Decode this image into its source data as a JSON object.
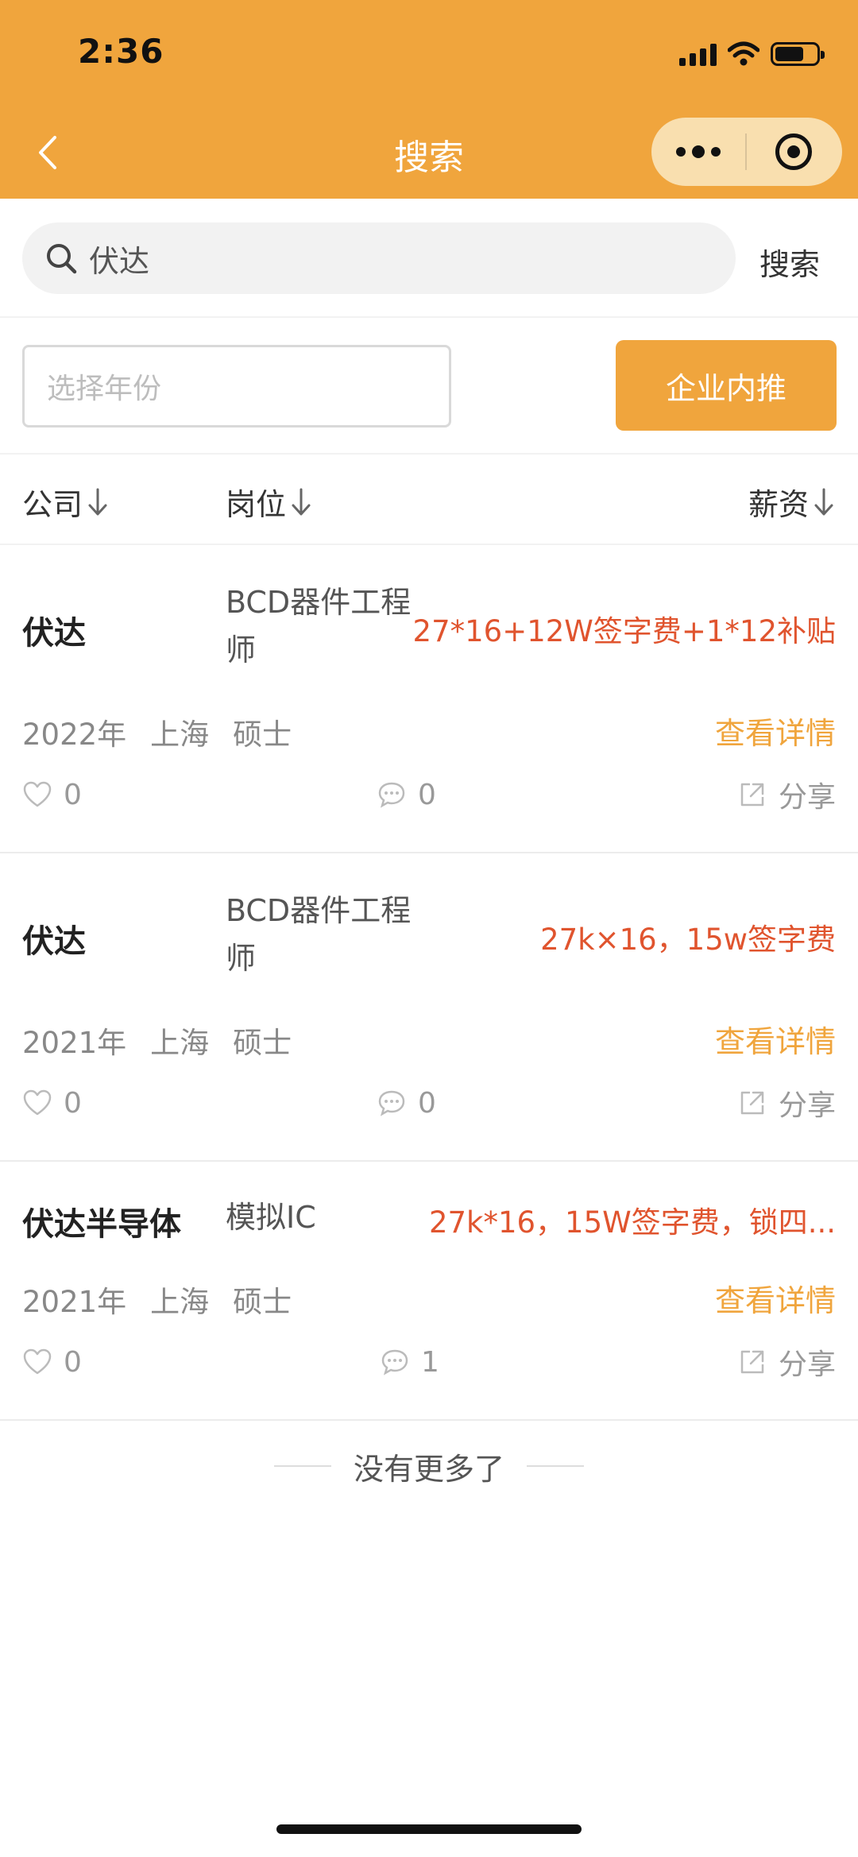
{
  "status_bar": {
    "time": "2:36"
  },
  "nav": {
    "title": "搜索"
  },
  "search": {
    "value": "伏达",
    "button_label": "搜索"
  },
  "filter": {
    "year_placeholder": "选择年份",
    "referral_label": "企业内推"
  },
  "columns": {
    "company": "公司",
    "position": "岗位",
    "salary": "薪资"
  },
  "jobs": [
    {
      "company": "伏达",
      "position": "BCD器件工程师",
      "salary": "27*16+12W签字费+1*12补贴",
      "year": "2022年",
      "city": "上海",
      "degree": "硕士",
      "detail_label": "查看详情",
      "likes": "0",
      "comments": "0",
      "share_label": "分享"
    },
    {
      "company": "伏达",
      "position": "BCD器件工程师",
      "salary": "27k×16，15w签字费",
      "year": "2021年",
      "city": "上海",
      "degree": "硕士",
      "detail_label": "查看详情",
      "likes": "0",
      "comments": "0",
      "share_label": "分享"
    },
    {
      "company": "伏达半导体",
      "position": "模拟IC",
      "salary": "27k*16，15W签字费，锁四...",
      "year": "2021年",
      "city": "上海",
      "degree": "硕士",
      "detail_label": "查看详情",
      "likes": "0",
      "comments": "1",
      "share_label": "分享"
    }
  ],
  "footer": {
    "end_text": "没有更多了"
  },
  "colors": {
    "accent": "#f0a53d",
    "salary": "#e0542e"
  }
}
